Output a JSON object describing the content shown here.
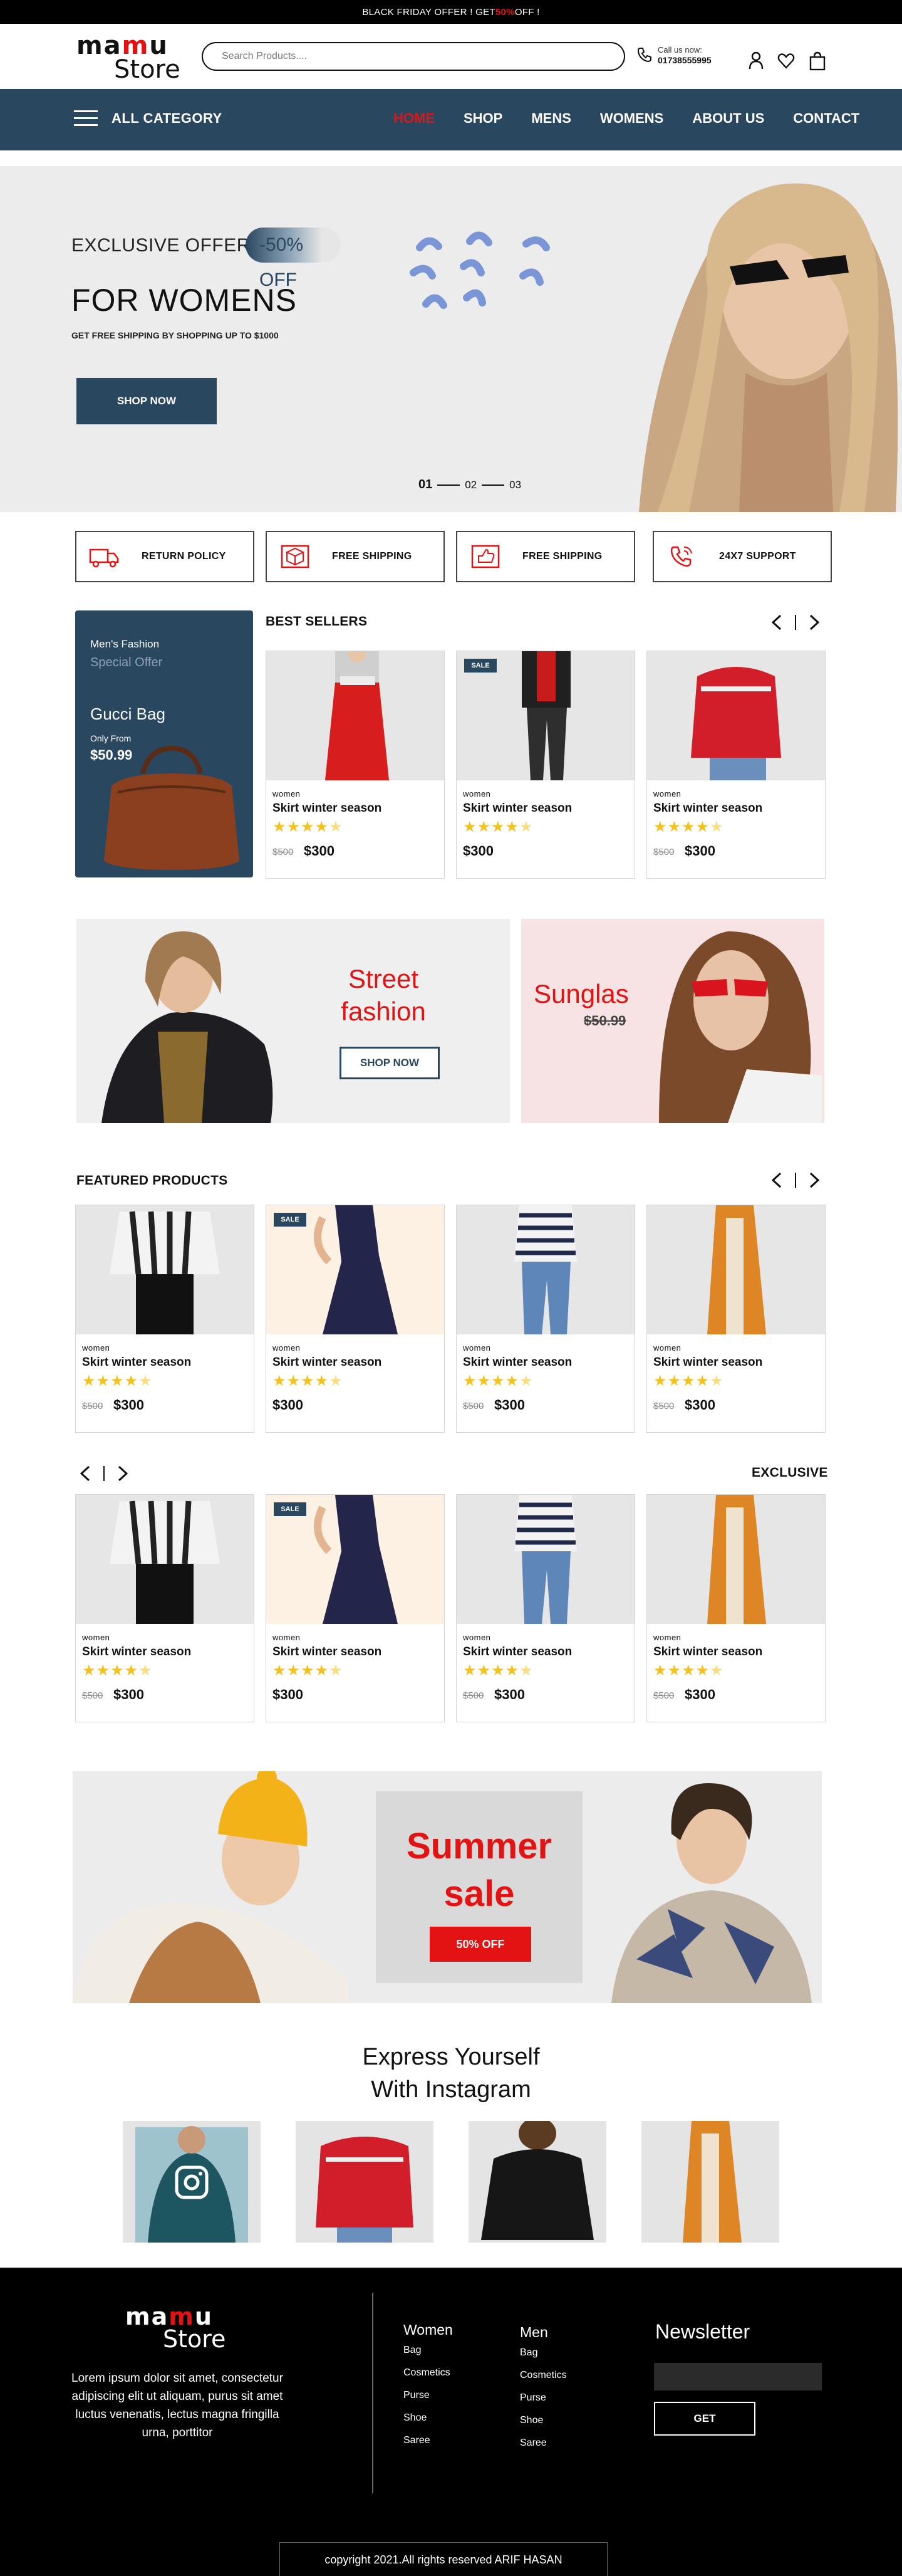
{
  "topbar": {
    "prefix": "BLACK FRIDAY OFFER ! GET ",
    "highlight": "50%",
    "suffix": " OFF !"
  },
  "header": {
    "logo_line1_a": "ma",
    "logo_line1_b": "m",
    "logo_line1_c": "u",
    "logo_line2": "Store",
    "search_placeholder": "Search Products....",
    "call_label": "Call us now:",
    "call_number": "01738555995",
    "icons": [
      "user-icon",
      "heart-icon",
      "bag-icon"
    ]
  },
  "nav": {
    "category_label": "ALL CATEGORY",
    "items": [
      {
        "label": "HOME",
        "active": true
      },
      {
        "label": "SHOP",
        "active": false
      },
      {
        "label": "MENS",
        "active": false
      },
      {
        "label": "WOMENS",
        "active": false
      },
      {
        "label": "ABOUT US",
        "active": false
      },
      {
        "label": "CONTACT",
        "active": false
      }
    ]
  },
  "hero": {
    "offer": "EXCLUSIVE OFFER",
    "discount": "-50% OFF",
    "title": "FOR WOMENS",
    "shipping": "GET FREE SHIPPING BY SHOPPING UP TO $1000",
    "button": "SHOP NOW",
    "slides": [
      "01",
      "02",
      "03"
    ]
  },
  "services": [
    {
      "icon": "truck-icon",
      "label": "RETURN POLICY"
    },
    {
      "icon": "box-icon",
      "label": "FREE SHIPPING"
    },
    {
      "icon": "thumbs-up-icon",
      "label": "FREE SHIPPING"
    },
    {
      "icon": "phone-icon",
      "label": "24X7 SUPPORT"
    }
  ],
  "promo": {
    "line1": "Men's Fashion",
    "line2": "Special Offer",
    "product": "Gucci Bag",
    "from": "Only From",
    "price": "$50.99"
  },
  "best_sellers": {
    "title": "BEST SELLERS",
    "products": [
      {
        "category": "women",
        "name": "Skirt winter season",
        "old": "$500",
        "price": "$300",
        "sale": ""
      },
      {
        "category": "women",
        "name": "Skirt winter season",
        "old": "",
        "price": "$300",
        "sale": "SALE"
      },
      {
        "category": "women",
        "name": "Skirt winter season",
        "old": "$500",
        "price": "$300",
        "sale": ""
      }
    ]
  },
  "banners": {
    "street_line1": "Street",
    "street_line2": "fashion",
    "street_button": "SHOP NOW",
    "sunglass_title": "Sunglas",
    "sunglass_old": "$50.99"
  },
  "featured": {
    "title": "FEATURED PRODUCTS",
    "products": [
      {
        "category": "women",
        "name": "Skirt winter season",
        "old": "$500",
        "price": "$300",
        "sale": ""
      },
      {
        "category": "women",
        "name": "Skirt winter season",
        "old": "",
        "price": "$300",
        "sale": "SALE"
      },
      {
        "category": "women",
        "name": "Skirt winter season",
        "old": "$500",
        "price": "$300",
        "sale": ""
      },
      {
        "category": "women",
        "name": "Skirt winter season",
        "old": "$500",
        "price": "$300",
        "sale": ""
      }
    ]
  },
  "exclusive": {
    "title": "EXCLUSIVE",
    "products": [
      {
        "category": "women",
        "name": "Skirt winter season",
        "old": "$500",
        "price": "$300",
        "sale": ""
      },
      {
        "category": "women",
        "name": "Skirt winter season",
        "old": "",
        "price": "$300",
        "sale": "SALE"
      },
      {
        "category": "women",
        "name": "Skirt winter season",
        "old": "$500",
        "price": "$300",
        "sale": ""
      },
      {
        "category": "women",
        "name": "Skirt winter season",
        "old": "$500",
        "price": "$300",
        "sale": ""
      }
    ]
  },
  "summer": {
    "line1": "Summer",
    "line2": "sale",
    "button": "50% OFF"
  },
  "instagram": {
    "line1": "Express Yourself",
    "line2": "With Instagram"
  },
  "footer": {
    "logo_line1_a": "ma",
    "logo_line1_b": "m",
    "logo_line1_c": "u",
    "logo_line2": "Store",
    "description": "Lorem ipsum dolor sit amet, consectetur adipiscing elit ut aliquam, purus sit amet luctus venenatis, lectus magna fringilla urna, porttitor",
    "women_title": "Women",
    "women_links": [
      "Bag",
      "Cosmetics",
      "Purse",
      "Shoe",
      "Saree"
    ],
    "men_title": "Men",
    "men_links": [
      "Bag",
      "Cosmetics",
      "Purse",
      "Shoe",
      "Saree"
    ],
    "newsletter_title": "Newsletter",
    "newsletter_placeholder": "",
    "newsletter_button": "GET",
    "copyright": "copyright 2021.All rights reserved ARIF HASAN"
  },
  "colors": {
    "brand": "#2a4760",
    "accent": "#e31313",
    "star": "#f6c11e"
  }
}
